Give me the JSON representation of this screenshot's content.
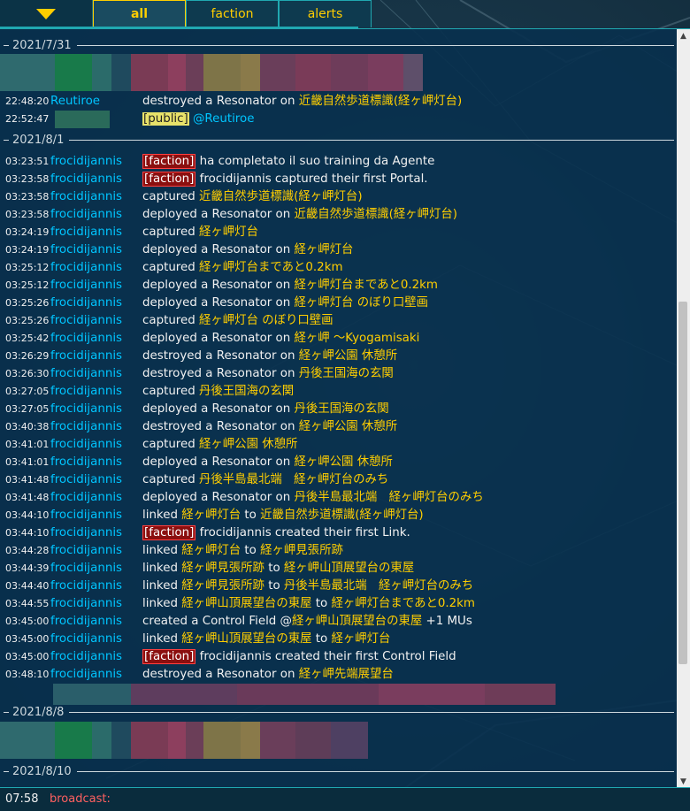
{
  "tabs": {
    "toggle_icon": "triangle-down-icon",
    "items": [
      {
        "label": "all",
        "active": true
      },
      {
        "label": "faction",
        "active": false
      },
      {
        "label": "alerts",
        "active": false
      }
    ]
  },
  "colors": {
    "accent": "#ffce00",
    "nick": "#00c5ff",
    "faction_tag": "#8b0f0f",
    "panel": "#08304e",
    "border": "#20a8b1"
  },
  "dates": [
    "2021/7/31",
    "2021/8/1",
    "2021/8/8",
    "2021/8/10"
  ],
  "messages": [
    {
      "time": "22:48:20",
      "nick": "Reutiroe",
      "parts": [
        [
          "t",
          "destroyed a Resonator on "
        ],
        [
          "p",
          "近畿自然歩道標識(経ヶ岬灯台)"
        ]
      ]
    },
    {
      "time": "22:52:47",
      "nick": "",
      "parts": [
        [
          "pub",
          "[public]"
        ],
        [
          "t",
          " "
        ],
        [
          "at",
          "@Reutiroe"
        ]
      ]
    },
    {
      "time": "03:23:51",
      "nick": "frocidijannis",
      "parts": [
        [
          "f",
          "[faction]"
        ],
        [
          "t",
          " ha completato il suo training da Agente"
        ]
      ]
    },
    {
      "time": "03:23:58",
      "nick": "frocidijannis",
      "parts": [
        [
          "f",
          "[faction]"
        ],
        [
          "t",
          " frocidijannis captured their first Portal."
        ]
      ]
    },
    {
      "time": "03:23:58",
      "nick": "frocidijannis",
      "parts": [
        [
          "t",
          "captured "
        ],
        [
          "p",
          "近畿自然歩道標識(経ヶ岬灯台)"
        ]
      ]
    },
    {
      "time": "03:23:58",
      "nick": "frocidijannis",
      "parts": [
        [
          "t",
          "deployed a Resonator on "
        ],
        [
          "p",
          "近畿自然歩道標識(経ヶ岬灯台)"
        ]
      ]
    },
    {
      "time": "03:24:19",
      "nick": "frocidijannis",
      "parts": [
        [
          "t",
          "captured "
        ],
        [
          "p",
          "経ヶ岬灯台"
        ]
      ]
    },
    {
      "time": "03:24:19",
      "nick": "frocidijannis",
      "parts": [
        [
          "t",
          "deployed a Resonator on "
        ],
        [
          "p",
          "経ヶ岬灯台"
        ]
      ]
    },
    {
      "time": "03:25:12",
      "nick": "frocidijannis",
      "parts": [
        [
          "t",
          "captured "
        ],
        [
          "p",
          "経ヶ岬灯台まであと0.2km"
        ]
      ]
    },
    {
      "time": "03:25:12",
      "nick": "frocidijannis",
      "parts": [
        [
          "t",
          "deployed a Resonator on "
        ],
        [
          "p",
          "経ヶ岬灯台まであと0.2km"
        ]
      ]
    },
    {
      "time": "03:25:26",
      "nick": "frocidijannis",
      "parts": [
        [
          "t",
          "deployed a Resonator on "
        ],
        [
          "p",
          "経ヶ岬灯台 のぼり口壁画"
        ]
      ]
    },
    {
      "time": "03:25:26",
      "nick": "frocidijannis",
      "parts": [
        [
          "t",
          "captured "
        ],
        [
          "p",
          "経ヶ岬灯台 のぼり口壁画"
        ]
      ]
    },
    {
      "time": "03:25:42",
      "nick": "frocidijannis",
      "parts": [
        [
          "t",
          "deployed a Resonator on "
        ],
        [
          "p",
          "経ヶ岬 〜Kyogamisaki"
        ]
      ]
    },
    {
      "time": "03:26:29",
      "nick": "frocidijannis",
      "parts": [
        [
          "t",
          "destroyed a Resonator on "
        ],
        [
          "p",
          "経ヶ岬公園 休憩所"
        ]
      ]
    },
    {
      "time": "03:26:30",
      "nick": "frocidijannis",
      "parts": [
        [
          "t",
          "destroyed a Resonator on "
        ],
        [
          "p",
          "丹後王国海の玄関"
        ]
      ]
    },
    {
      "time": "03:27:05",
      "nick": "frocidijannis",
      "parts": [
        [
          "t",
          "captured "
        ],
        [
          "p",
          "丹後王国海の玄関"
        ]
      ]
    },
    {
      "time": "03:27:05",
      "nick": "frocidijannis",
      "parts": [
        [
          "t",
          "deployed a Resonator on "
        ],
        [
          "p",
          "丹後王国海の玄関"
        ]
      ]
    },
    {
      "time": "03:40:38",
      "nick": "frocidijannis",
      "parts": [
        [
          "t",
          "destroyed a Resonator on "
        ],
        [
          "p",
          "経ヶ岬公園 休憩所"
        ]
      ]
    },
    {
      "time": "03:41:01",
      "nick": "frocidijannis",
      "parts": [
        [
          "t",
          "captured "
        ],
        [
          "p",
          "経ヶ岬公園 休憩所"
        ]
      ]
    },
    {
      "time": "03:41:01",
      "nick": "frocidijannis",
      "parts": [
        [
          "t",
          "deployed a Resonator on "
        ],
        [
          "p",
          "経ヶ岬公園 休憩所"
        ]
      ]
    },
    {
      "time": "03:41:48",
      "nick": "frocidijannis",
      "parts": [
        [
          "t",
          "captured "
        ],
        [
          "p",
          "丹後半島最北端　経ヶ岬灯台のみち"
        ]
      ]
    },
    {
      "time": "03:41:48",
      "nick": "frocidijannis",
      "parts": [
        [
          "t",
          "deployed a Resonator on "
        ],
        [
          "p",
          "丹後半島最北端　経ヶ岬灯台のみち"
        ]
      ]
    },
    {
      "time": "03:44:10",
      "nick": "frocidijannis",
      "parts": [
        [
          "t",
          "linked "
        ],
        [
          "p",
          "経ヶ岬灯台"
        ],
        [
          "t",
          " to "
        ],
        [
          "p",
          "近畿自然歩道標識(経ヶ岬灯台)"
        ]
      ]
    },
    {
      "time": "03:44:10",
      "nick": "frocidijannis",
      "parts": [
        [
          "f",
          "[faction]"
        ],
        [
          "t",
          " frocidijannis created their first Link."
        ]
      ]
    },
    {
      "time": "03:44:28",
      "nick": "frocidijannis",
      "parts": [
        [
          "t",
          "linked "
        ],
        [
          "p",
          "経ヶ岬灯台"
        ],
        [
          "t",
          " to "
        ],
        [
          "p",
          "経ヶ岬見張所跡"
        ]
      ]
    },
    {
      "time": "03:44:39",
      "nick": "frocidijannis",
      "parts": [
        [
          "t",
          "linked "
        ],
        [
          "p",
          "経ヶ岬見張所跡"
        ],
        [
          "t",
          " to "
        ],
        [
          "p",
          "経ヶ岬山頂展望台の東屋"
        ]
      ]
    },
    {
      "time": "03:44:40",
      "nick": "frocidijannis",
      "parts": [
        [
          "t",
          "linked "
        ],
        [
          "p",
          "経ヶ岬見張所跡"
        ],
        [
          "t",
          " to "
        ],
        [
          "p",
          "丹後半島最北端　経ヶ岬灯台のみち"
        ]
      ]
    },
    {
      "time": "03:44:55",
      "nick": "frocidijannis",
      "parts": [
        [
          "t",
          "linked "
        ],
        [
          "p",
          "経ヶ岬山頂展望台の東屋"
        ],
        [
          "t",
          " to "
        ],
        [
          "p",
          "経ヶ岬灯台まであと0.2km"
        ]
      ]
    },
    {
      "time": "03:45:00",
      "nick": "frocidijannis",
      "parts": [
        [
          "t",
          "created a Control Field @"
        ],
        [
          "p",
          "経ヶ岬山頂展望台の東屋"
        ],
        [
          "t",
          " +1 MUs"
        ]
      ]
    },
    {
      "time": "03:45:00",
      "nick": "frocidijannis",
      "parts": [
        [
          "t",
          "linked "
        ],
        [
          "p",
          "経ヶ岬山頂展望台の東屋"
        ],
        [
          "t",
          " to "
        ],
        [
          "p",
          "経ヶ岬灯台"
        ]
      ]
    },
    {
      "time": "03:45:00",
      "nick": "frocidijannis",
      "parts": [
        [
          "f",
          "[faction]"
        ],
        [
          "t",
          " frocidijannis created their first Control Field"
        ]
      ]
    },
    {
      "time": "03:48:10",
      "nick": "frocidijannis",
      "parts": [
        [
          "t",
          "destroyed a Resonator on "
        ],
        [
          "p",
          "経ヶ岬先端展望台"
        ]
      ]
    }
  ],
  "input": {
    "time": "07:58",
    "label": "broadcast:"
  }
}
